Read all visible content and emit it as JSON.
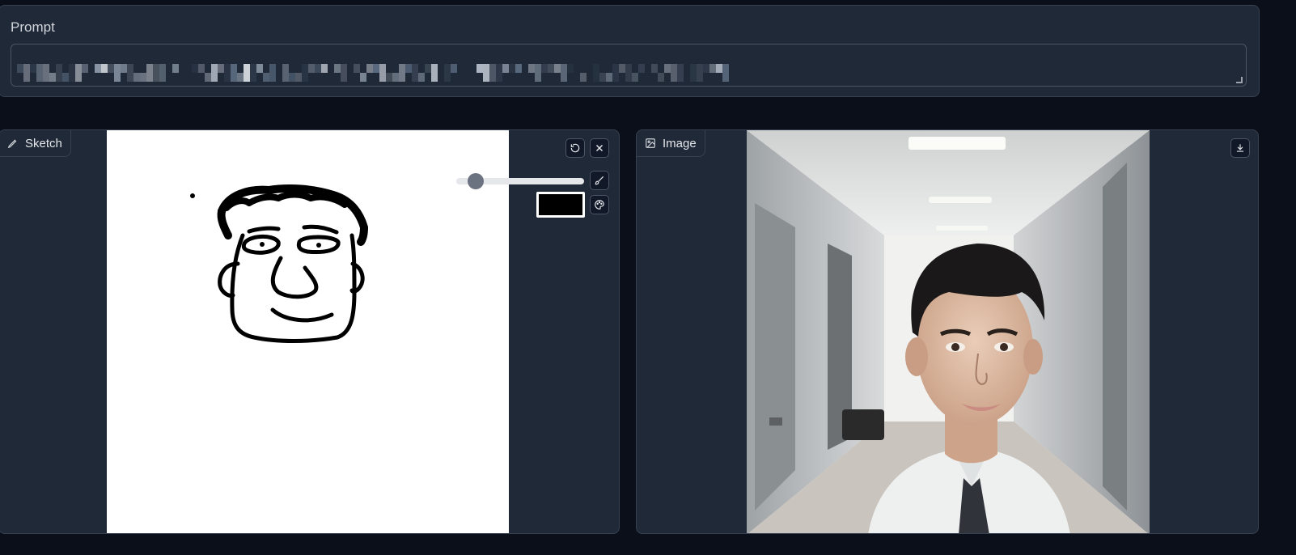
{
  "prompt": {
    "label": "Prompt",
    "text_redacted": true
  },
  "sketch_panel": {
    "tag_label": "Sketch",
    "tag_icon": "pencil-icon",
    "undo_icon": "undo-icon",
    "clear_icon": "close-icon",
    "brush_icon": "brush-icon",
    "palette_icon": "palette-icon",
    "brush_size_fraction": 0.1,
    "brush_color": "#000000"
  },
  "image_panel": {
    "tag_label": "Image",
    "tag_icon": "image-icon",
    "download_icon": "download-icon"
  },
  "colors": {
    "background": "#0b0f19",
    "panel": "#1f2937",
    "border": "#374151"
  }
}
